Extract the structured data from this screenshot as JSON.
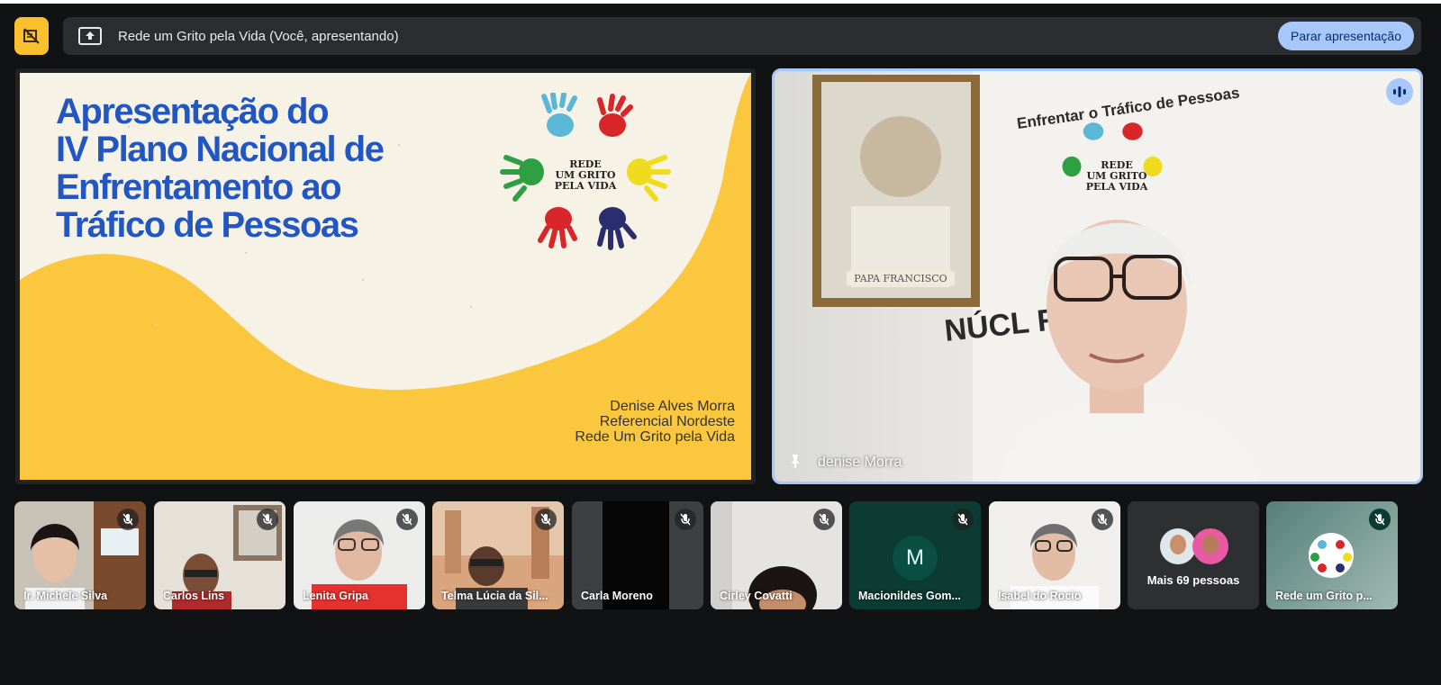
{
  "presentation_bar": {
    "title": "Rede um Grito pela Vida (Você, apresentando)",
    "stop_label": "Parar apresentação"
  },
  "slide": {
    "title_lines": [
      "Apresentação do",
      "IV Plano Nacional de",
      "Enfrentamento ao",
      "Tráfico de Pessoas"
    ],
    "logo_lines": [
      "REDE",
      "UM GRITO",
      "PELA VIDA"
    ],
    "presenter_lines": [
      "Denise Alves Morra",
      "Referencial Nordeste",
      "Rede Um Grito pela Vida"
    ],
    "colors": {
      "title": "#2256c0",
      "background": "#f6f2e6",
      "accent": "#fbc73e"
    }
  },
  "speaker": {
    "name": "denise Morra",
    "banner_text": "Enfrentar o Tráfico de Pessoas",
    "banner_logo_lines": [
      "REDE",
      "UM GRITO",
      "PELA VIDA"
    ],
    "banner_bottom_text": "NÚCL      RESINA",
    "portrait_caption": "PAPA FRANCISCO"
  },
  "participants": [
    {
      "name": "Ir. Michele Silva",
      "muted": true
    },
    {
      "name": "Carlos Lins",
      "muted": true
    },
    {
      "name": "Lenita Gripa",
      "muted": true
    },
    {
      "name": "Telma Lúcia da Sil...",
      "muted": true
    },
    {
      "name": "Carla Moreno",
      "muted": true
    },
    {
      "name": "Cirley Covatti",
      "muted": true
    },
    {
      "name": "Macionildes Gom...",
      "muted": true,
      "initial": "M"
    },
    {
      "name": "Isabel do Rocio",
      "muted": true
    }
  ],
  "more_participants": {
    "label": "Mais 69 pessoas"
  },
  "self_tile": {
    "name": "Rede um Grito p...",
    "muted": true
  }
}
